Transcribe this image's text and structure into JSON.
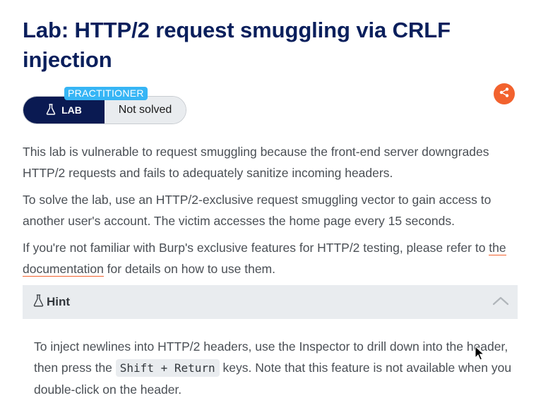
{
  "lab": {
    "title": "Lab: HTTP/2 request smuggling via CRLF injection",
    "level": "PRACTITIONER",
    "badge_label": "LAB",
    "status": "Not solved"
  },
  "description": {
    "p1": "This lab is vulnerable to request smuggling because the front-end server downgrades HTTP/2 requests and fails to adequately sanitize incoming headers.",
    "p2": "To solve the lab, use an HTTP/2-exclusive request smuggling vector to gain access to another user's account. The victim accesses the home page every 15 seconds.",
    "p3_before": "If you're not familiar with Burp's exclusive features for HTTP/2 testing, please refer to ",
    "p3_link": "the documentation",
    "p3_after": " for details on how to use them."
  },
  "hint": {
    "title": "Hint",
    "text_before": "To inject newlines into HTTP/2 headers, use the Inspector to drill down into the header, then press the ",
    "keys": "Shift + Return",
    "text_after": " keys. Note that this feature is not available when you double-click on the header."
  },
  "icons": {
    "badge": "flask-icon",
    "share": "share-icon",
    "hint": "flask-icon",
    "collapse": "chevron-up-icon"
  },
  "colors": {
    "title": "#0a1f5c",
    "badge_dark": "#0a1a52",
    "level_tag": "#36b5f5",
    "share": "#f2622e",
    "hint_bar": "#e9ecef"
  }
}
